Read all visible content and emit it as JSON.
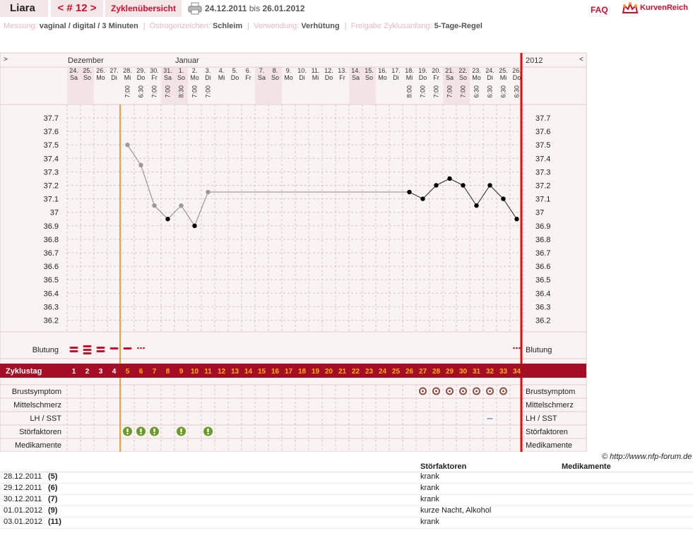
{
  "header": {
    "user_name": "Liara",
    "cycle_label": "< # 12 >",
    "overview_link": "Zyklenübersicht",
    "printer_icon": "printer-icon",
    "date_from": "24.12.2011",
    "date_sep": "bis",
    "date_to": "26.01.2012",
    "faq": "FAQ",
    "logo_text": "KurvenReich",
    "logo_icon": "crown-icon"
  },
  "info": [
    {
      "label": "Messung:",
      "value": "vaginal / digital / 3 Minuten"
    },
    {
      "label": "Östrogenzeichen:",
      "value": "Schleim"
    },
    {
      "label": "Verwendung:",
      "value": "Verhütung"
    },
    {
      "label": "Freigabe Zyklusanfang:",
      "value": "5-Tage-Regel"
    }
  ],
  "chart_data": {
    "type": "line",
    "title": "",
    "nav_left": ">",
    "nav_right": "<",
    "year_label": "2012",
    "months": [
      {
        "label": "Dezember",
        "col": 0
      },
      {
        "label": "Januar",
        "col": 8
      }
    ],
    "days": [
      {
        "d": "24.",
        "w": "Sa",
        "t": "",
        "we": true
      },
      {
        "d": "25.",
        "w": "So",
        "t": "",
        "we": true
      },
      {
        "d": "26.",
        "w": "Mo",
        "t": "",
        "we": false
      },
      {
        "d": "27.",
        "w": "Di",
        "t": "",
        "we": false
      },
      {
        "d": "28.",
        "w": "Mi",
        "t": "7:00",
        "we": false
      },
      {
        "d": "29.",
        "w": "Do",
        "t": "6:30",
        "we": false
      },
      {
        "d": "30.",
        "w": "Fr",
        "t": "7:00",
        "we": false
      },
      {
        "d": "31.",
        "w": "Sa",
        "t": "7:00",
        "we": true
      },
      {
        "d": "1.",
        "w": "So",
        "t": "8:30",
        "we": true
      },
      {
        "d": "2.",
        "w": "Mo",
        "t": "7:00",
        "we": false
      },
      {
        "d": "3.",
        "w": "Di",
        "t": "7:00",
        "we": false
      },
      {
        "d": "4.",
        "w": "Mi",
        "t": "",
        "we": false
      },
      {
        "d": "5.",
        "w": "Do",
        "t": "",
        "we": false
      },
      {
        "d": "6.",
        "w": "Fr",
        "t": "",
        "we": false
      },
      {
        "d": "7.",
        "w": "Sa",
        "t": "",
        "we": true
      },
      {
        "d": "8.",
        "w": "So",
        "t": "",
        "we": true
      },
      {
        "d": "9.",
        "w": "Mo",
        "t": "",
        "we": false
      },
      {
        "d": "10.",
        "w": "Di",
        "t": "",
        "we": false
      },
      {
        "d": "11.",
        "w": "Mi",
        "t": "",
        "we": false
      },
      {
        "d": "12.",
        "w": "Do",
        "t": "",
        "we": false
      },
      {
        "d": "13.",
        "w": "Fr",
        "t": "",
        "we": false
      },
      {
        "d": "14.",
        "w": "Sa",
        "t": "",
        "we": true
      },
      {
        "d": "15.",
        "w": "So",
        "t": "",
        "we": true
      },
      {
        "d": "16.",
        "w": "Mo",
        "t": "",
        "we": false
      },
      {
        "d": "17.",
        "w": "Di",
        "t": "",
        "we": false
      },
      {
        "d": "18.",
        "w": "Mi",
        "t": "8:00",
        "we": false
      },
      {
        "d": "19.",
        "w": "Do",
        "t": "7:00",
        "we": false
      },
      {
        "d": "20.",
        "w": "Fr",
        "t": "7:00",
        "we": false
      },
      {
        "d": "21.",
        "w": "Sa",
        "t": "7:00",
        "we": true
      },
      {
        "d": "22.",
        "w": "So",
        "t": "7:00",
        "we": true
      },
      {
        "d": "23.",
        "w": "Mo",
        "t": "6:30",
        "we": false
      },
      {
        "d": "24.",
        "w": "Di",
        "t": "6:30",
        "we": false
      },
      {
        "d": "25.",
        "w": "Mi",
        "t": "6:30",
        "we": false
      },
      {
        "d": "26.",
        "w": "Do",
        "t": "6:30",
        "we": false
      }
    ],
    "y_ticks": [
      "37.7",
      "37.6",
      "37.5",
      "37.4",
      "37.3",
      "37.2",
      "37.1",
      "37",
      "36.9",
      "36.8",
      "36.7",
      "36.6",
      "36.5",
      "36.4",
      "36.3",
      "36.2"
    ],
    "ylim": [
      36.2,
      37.7
    ],
    "temperatures": [
      {
        "cycle_day": 5,
        "value": 37.5,
        "disturbed": true
      },
      {
        "cycle_day": 6,
        "value": 37.35,
        "disturbed": true
      },
      {
        "cycle_day": 7,
        "value": 37.05,
        "disturbed": true
      },
      {
        "cycle_day": 8,
        "value": 36.95,
        "disturbed": false
      },
      {
        "cycle_day": 9,
        "value": 37.05,
        "disturbed": true
      },
      {
        "cycle_day": 10,
        "value": 36.9,
        "disturbed": false
      },
      {
        "cycle_day": 11,
        "value": 37.15,
        "disturbed": true
      },
      {
        "cycle_day": 26,
        "value": 37.15,
        "disturbed": false
      },
      {
        "cycle_day": 27,
        "value": 37.1,
        "disturbed": false
      },
      {
        "cycle_day": 28,
        "value": 37.2,
        "disturbed": false
      },
      {
        "cycle_day": 29,
        "value": 37.25,
        "disturbed": false
      },
      {
        "cycle_day": 30,
        "value": 37.2,
        "disturbed": false
      },
      {
        "cycle_day": 31,
        "value": 37.05,
        "disturbed": false
      },
      {
        "cycle_day": 32,
        "value": 37.2,
        "disturbed": false
      },
      {
        "cycle_day": 33,
        "value": 37.1,
        "disturbed": false
      },
      {
        "cycle_day": 34,
        "value": 36.95,
        "disturbed": false
      }
    ],
    "cycle_start_line_day": 5,
    "bleeding_label": "Blutung",
    "bleeding": [
      {
        "cycle_day": 1,
        "level": "medium"
      },
      {
        "cycle_day": 2,
        "level": "heavy"
      },
      {
        "cycle_day": 3,
        "level": "medium"
      },
      {
        "cycle_day": 4,
        "level": "light"
      },
      {
        "cycle_day": 5,
        "level": "light"
      },
      {
        "cycle_day": 6,
        "level": "spotting"
      },
      {
        "cycle_day": 34,
        "level": "spotting"
      }
    ],
    "cycle_day_label": "Zyklustag",
    "cycle_days": [
      "1",
      "2",
      "3",
      "4",
      "5",
      "6",
      "7",
      "8",
      "9",
      "10",
      "11",
      "12",
      "13",
      "14",
      "15",
      "16",
      "17",
      "18",
      "19",
      "20",
      "21",
      "22",
      "23",
      "24",
      "25",
      "26",
      "27",
      "28",
      "29",
      "30",
      "31",
      "32",
      "33",
      "34"
    ],
    "rows": [
      {
        "label": "Brustsymptom",
        "marks": [
          27,
          28,
          29,
          30,
          31,
          32,
          33
        ],
        "icon": "circle-symptom-icon"
      },
      {
        "label": "Mittelschmerz",
        "marks": [],
        "icon": ""
      },
      {
        "label": "LH / SST",
        "marks": [
          32
        ],
        "icon": "dash-icon"
      },
      {
        "label": "Störfaktoren",
        "marks": [
          5,
          6,
          7,
          9,
          11
        ],
        "icon": "exclamation-icon"
      },
      {
        "label": "Medikamente",
        "marks": [],
        "icon": ""
      }
    ],
    "colors": {
      "accent": "#c8102e",
      "cycle_bar": "#a50d24",
      "cycle_number_pre": "#ffffff",
      "cycle_number_post": "#ffb000",
      "weekend": "#f3e3e6",
      "start_line": "#f0a030",
      "end_line": "#d81010",
      "temp_disturbed": "#999999",
      "temp_normal": "#000000",
      "disturbance_icon": "#6a9a28",
      "breast_icon": "#8c5040"
    }
  },
  "copyright": "© http://www.nfp-forum.de",
  "notes_table": {
    "col_disturbance": "Störfaktoren",
    "col_medication": "Medikamente",
    "rows": [
      {
        "date": "28.12.2011",
        "day": "(5)",
        "disturbance": "krank"
      },
      {
        "date": "29.12.2011",
        "day": "(6)",
        "disturbance": "krank"
      },
      {
        "date": "30.12.2011",
        "day": "(7)",
        "disturbance": "krank"
      },
      {
        "date": "01.01.2012",
        "day": "(9)",
        "disturbance": "kurze Nacht, Alkohol"
      },
      {
        "date": "03.01.2012",
        "day": "(11)",
        "disturbance": "krank"
      }
    ]
  }
}
